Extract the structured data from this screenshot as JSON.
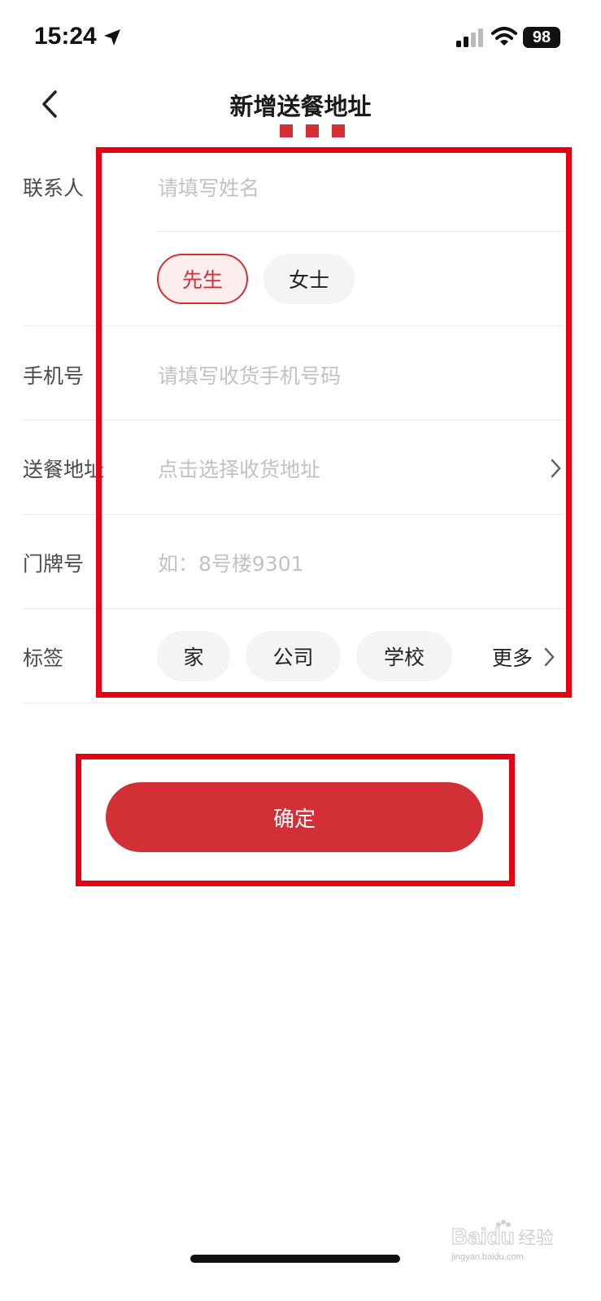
{
  "status_bar": {
    "time": "15:24",
    "battery": "98"
  },
  "header": {
    "title": "新增送餐地址"
  },
  "form": {
    "contact": {
      "label": "联系人",
      "placeholder": "请填写姓名",
      "gender_options": [
        {
          "label": "先生",
          "selected": true
        },
        {
          "label": "女士",
          "selected": false
        }
      ]
    },
    "phone": {
      "label": "手机号",
      "placeholder": "请填写收货手机号码"
    },
    "address": {
      "label": "送餐地址",
      "placeholder": "点击选择收货地址"
    },
    "door_number": {
      "label": "门牌号",
      "placeholder": "如：8号楼9301"
    },
    "tags": {
      "label": "标签",
      "options": [
        "家",
        "公司",
        "学校"
      ],
      "more_label": "更多"
    }
  },
  "confirm_label": "确定",
  "watermark": {
    "logo_text": "Baidu经验",
    "url": "jingyan.baidu.com"
  },
  "colors": {
    "accent": "#d32f37",
    "annotation": "#e60012",
    "placeholder": "#c2c2c2"
  },
  "icons": {
    "location": "location-arrow-icon",
    "signal": "cellular-signal-icon",
    "wifi": "wifi-icon",
    "back": "chevron-left-icon",
    "chevron": "chevron-right-icon"
  }
}
